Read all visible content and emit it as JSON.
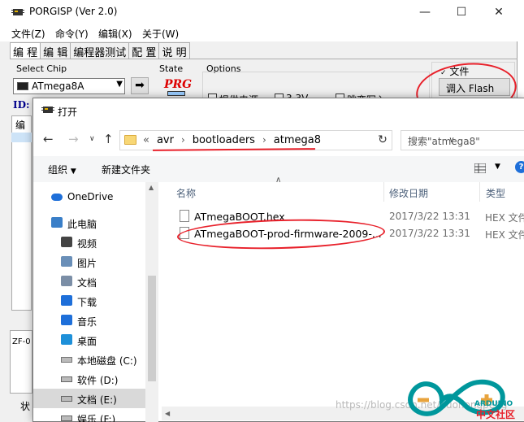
{
  "background_app": {
    "title": "PORGISP (Ver 2.0)",
    "menus": [
      "文件(Z)",
      "命令(Y)",
      "编辑(X)",
      "关于(W)"
    ],
    "tabs": [
      "编 程",
      "编 辑",
      "编程器测试",
      "配 置",
      "说 明"
    ],
    "select_chip_label": "Select Chip",
    "chip_value": "ATmega8A",
    "state_label": "State",
    "options_label": "Options",
    "prg_label": "PRG",
    "file_group_label": "文件",
    "flash_button": "调入 Flash",
    "id_label": "ID:",
    "edit_label": "编",
    "zf_label": "ZF-0",
    "status_label": "状",
    "option_checks": [
      "提供电源",
      "3.3V",
      "跳变写入"
    ]
  },
  "dialog": {
    "title": "打开",
    "breadcrumb_lead": "«",
    "breadcrumb": [
      "avr",
      "bootloaders",
      "atmega8"
    ],
    "search_placeholder": "搜索\"atmega8\"",
    "toolbar": {
      "organize": "组织",
      "new_folder": "新建文件夹"
    },
    "sidebar": [
      {
        "label": "OneDrive",
        "icon": "cloud-icon"
      },
      {
        "label": "此电脑",
        "icon": "computer-icon"
      },
      {
        "label": "视频",
        "icon": "video-icon"
      },
      {
        "label": "图片",
        "icon": "picture-icon"
      },
      {
        "label": "文档",
        "icon": "document-icon"
      },
      {
        "label": "下载",
        "icon": "download-icon"
      },
      {
        "label": "音乐",
        "icon": "music-icon"
      },
      {
        "label": "桌面",
        "icon": "desktop-icon"
      },
      {
        "label": "本地磁盘 (C:)",
        "icon": "windows-drive-icon"
      },
      {
        "label": "软件 (D:)",
        "icon": "drive-icon"
      },
      {
        "label": "文档 (E:)",
        "icon": "drive-icon"
      },
      {
        "label": "娱乐 (F:)",
        "icon": "drive-icon"
      }
    ],
    "columns": [
      "名称",
      "修改日期",
      "类型"
    ],
    "files": [
      {
        "name": "ATmegaBOOT.hex",
        "date": "2017/3/22 13:31",
        "type": "HEX 文件"
      },
      {
        "name": "ATmegaBOOT-prod-firmware-2009-...",
        "date": "2017/3/22 13:31",
        "type": "HEX 文件"
      }
    ]
  },
  "watermark": "https://blog.csdn.net/huohongpeng",
  "logo": {
    "name": "ARDUINO",
    "tagline": "中文社区"
  },
  "colors": {
    "annotation_red": "#e8202a",
    "selection_gray": "#d9d9d9",
    "column_header": "#4c607a",
    "prg_red": "#dd0000"
  }
}
